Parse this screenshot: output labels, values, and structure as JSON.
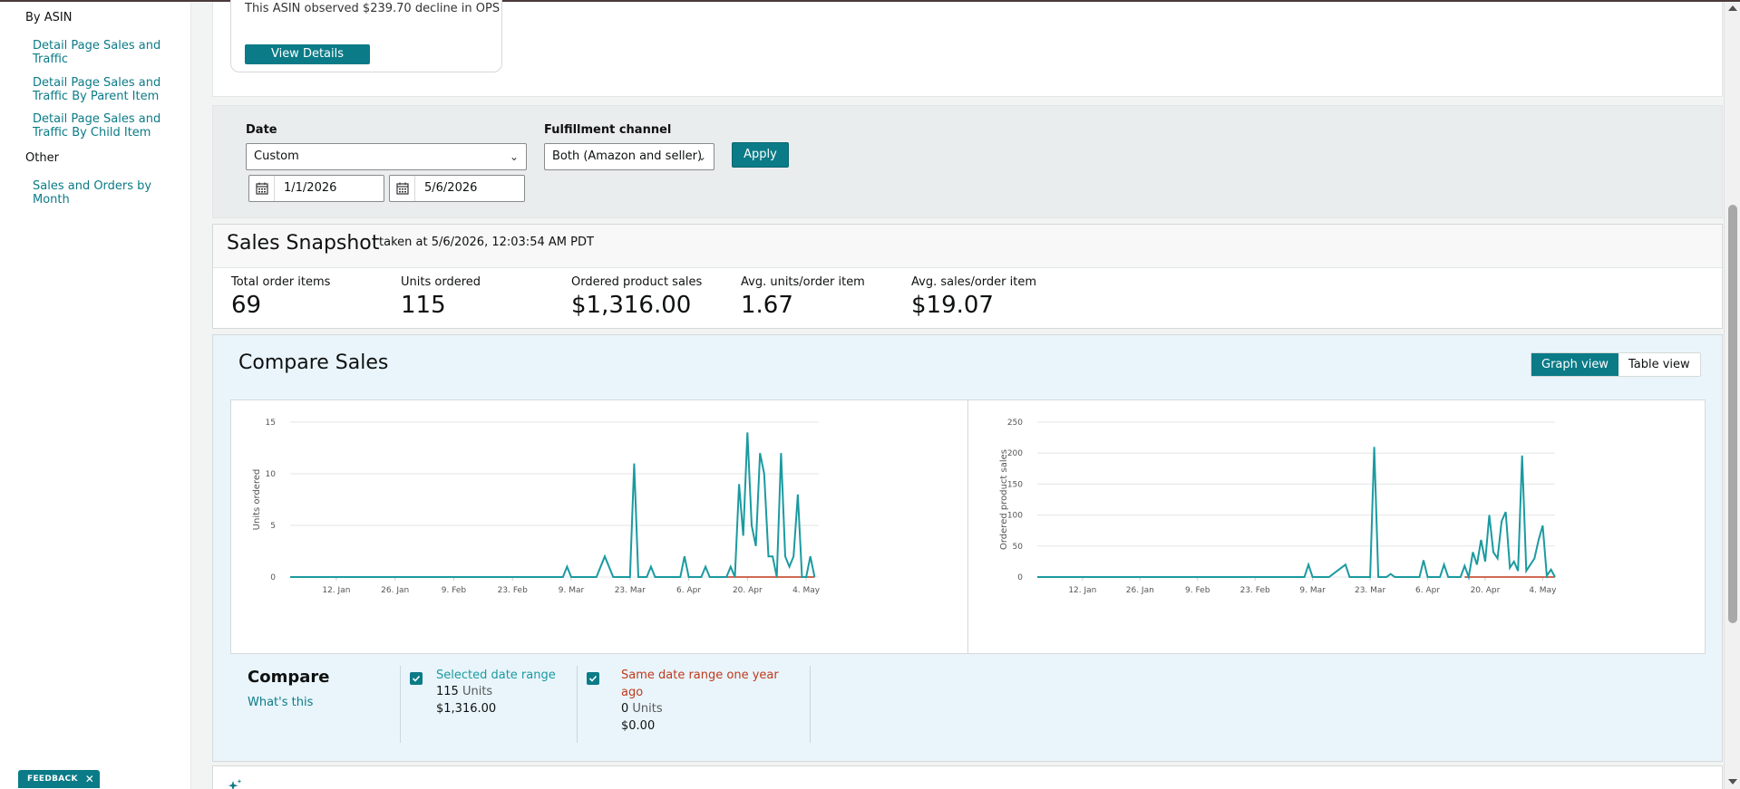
{
  "sidebar": {
    "header_by_asin": "By ASIN",
    "links_by_asin": [
      {
        "line1": "Detail Page Sales and",
        "line2": "Traffic"
      },
      {
        "line1": "Detail Page Sales and",
        "line2": "Traffic By Parent Item"
      },
      {
        "line1": "Detail Page Sales and",
        "line2": "Traffic By Child Item"
      }
    ],
    "header_other": "Other",
    "links_other": [
      {
        "line1": "Sales and Orders by",
        "line2": "Month"
      }
    ],
    "feedback_label": "FEEDBACK",
    "feedback_close": "✕"
  },
  "insight_card": {
    "text": "This ASIN observed $239.70 decline in OPS",
    "button_label": "View Details"
  },
  "filters": {
    "date_label": "Date",
    "date_value": "Custom",
    "start_date": "1/1/2026",
    "end_date": "5/6/2026",
    "fulfillment_label": "Fulfillment channel",
    "fulfillment_value": "Both (Amazon and seller)",
    "apply_label": "Apply"
  },
  "snapshot": {
    "title": "Sales Snapshot",
    "taken_at": "taken at 5/6/2026, 12:03:54 AM PDT",
    "metrics": [
      {
        "label": "Total order items",
        "value": "69"
      },
      {
        "label": "Units ordered",
        "value": "115"
      },
      {
        "label": "Ordered product sales",
        "value": "$1,316.00"
      },
      {
        "label": "Avg. units/order item",
        "value": "1.67"
      },
      {
        "label": "Avg. sales/order item",
        "value": "$19.07"
      }
    ]
  },
  "compare_sales": {
    "title": "Compare Sales",
    "view_toggle": {
      "graph": "Graph view",
      "table": "Table view",
      "active": "graph"
    },
    "compare_label": "Compare",
    "whats_this": "What's this",
    "legend": [
      {
        "name": "Selected date range",
        "units_value": "115",
        "units_label": "Units",
        "sales": "$1,316.00",
        "color": "#1b9aa0"
      },
      {
        "name": "Same date range one year ago",
        "name_line1": "Same date range one year",
        "name_line2": "ago",
        "units_value": "0",
        "units_label": "Units",
        "sales": "$0.00",
        "color": "#c0391b"
      }
    ]
  },
  "chart_data": [
    {
      "type": "line",
      "ylabel": "Units ordered",
      "ylim": [
        0,
        15
      ],
      "yticks": [
        0,
        5,
        10,
        15
      ],
      "xticks": [
        "12. Jan",
        "26. Jan",
        "9. Feb",
        "23. Feb",
        "9. Mar",
        "23. Mar",
        "6. Apr",
        "20. Apr",
        "4. May"
      ],
      "x_range_days": [
        0,
        126
      ],
      "xtick_days": [
        11,
        25,
        39,
        53,
        67,
        81,
        95,
        109,
        123
      ],
      "grid": true,
      "series": [
        {
          "name": "Selected date range",
          "color": "#1b9aa0",
          "points": [
            [
              0,
              0
            ],
            [
              65,
              0
            ],
            [
              66,
              1
            ],
            [
              67,
              0
            ],
            [
              73,
              0
            ],
            [
              75,
              2
            ],
            [
              77,
              0
            ],
            [
              81,
              0
            ],
            [
              82,
              11
            ],
            [
              83,
              0
            ],
            [
              85,
              0
            ],
            [
              86,
              1
            ],
            [
              87,
              0
            ],
            [
              93,
              0
            ],
            [
              94,
              2
            ],
            [
              95,
              0
            ],
            [
              98,
              0
            ],
            [
              99,
              1
            ],
            [
              100,
              0
            ],
            [
              104,
              0
            ],
            [
              105,
              1
            ],
            [
              106,
              0
            ],
            [
              107,
              9
            ],
            [
              108,
              4
            ],
            [
              109,
              14
            ],
            [
              110,
              5
            ],
            [
              111,
              3
            ],
            [
              112,
              12
            ],
            [
              113,
              10
            ],
            [
              114,
              2
            ],
            [
              115,
              2
            ],
            [
              116,
              0
            ],
            [
              117,
              12
            ],
            [
              118,
              2
            ],
            [
              119,
              1
            ],
            [
              120,
              2
            ],
            [
              121,
              8
            ],
            [
              122,
              0
            ],
            [
              123,
              0
            ],
            [
              124,
              2
            ],
            [
              125,
              0
            ]
          ]
        },
        {
          "name": "Same date range one year ago",
          "color": "#c0391b",
          "points": [
            [
              104,
              0
            ],
            [
              125,
              0
            ]
          ]
        }
      ]
    },
    {
      "type": "line",
      "ylabel": "Ordered product sales",
      "ylim": [
        0,
        250
      ],
      "yticks": [
        0,
        50,
        100,
        150,
        200,
        250
      ],
      "xticks": [
        "12. Jan",
        "26. Jan",
        "9. Feb",
        "23. Feb",
        "9. Mar",
        "23. Mar",
        "6. Apr",
        "20. Apr",
        "4. May"
      ],
      "x_range_days": [
        0,
        126
      ],
      "xtick_days": [
        11,
        25,
        39,
        53,
        67,
        81,
        95,
        109,
        123
      ],
      "grid": true,
      "series": [
        {
          "name": "Selected date range",
          "color": "#1b9aa0",
          "points": [
            [
              0,
              0
            ],
            [
              65,
              0
            ],
            [
              66,
              20
            ],
            [
              67,
              0
            ],
            [
              71,
              0
            ],
            [
              75,
              20
            ],
            [
              76,
              0
            ],
            [
              81,
              0
            ],
            [
              82,
              210
            ],
            [
              83,
              0
            ],
            [
              85,
              0
            ],
            [
              86,
              5
            ],
            [
              87,
              0
            ],
            [
              93,
              0
            ],
            [
              94,
              27
            ],
            [
              95,
              0
            ],
            [
              98,
              0
            ],
            [
              99,
              20
            ],
            [
              100,
              0
            ],
            [
              103,
              0
            ],
            [
              104,
              18
            ],
            [
              105,
              0
            ],
            [
              106,
              40
            ],
            [
              107,
              20
            ],
            [
              108,
              60
            ],
            [
              109,
              25
            ],
            [
              110,
              100
            ],
            [
              111,
              40
            ],
            [
              112,
              30
            ],
            [
              113,
              90
            ],
            [
              114,
              105
            ],
            [
              115,
              15
            ],
            [
              116,
              25
            ],
            [
              117,
              10
            ],
            [
              118,
              196
            ],
            [
              119,
              10
            ],
            [
              120,
              20
            ],
            [
              121,
              30
            ],
            [
              122,
              60
            ],
            [
              123,
              83
            ],
            [
              124,
              2
            ],
            [
              125,
              12
            ],
            [
              126,
              0
            ]
          ]
        },
        {
          "name": "Same date range one year ago",
          "color": "#c0391b",
          "points": [
            [
              104,
              0
            ],
            [
              126,
              0
            ]
          ]
        }
      ]
    }
  ]
}
